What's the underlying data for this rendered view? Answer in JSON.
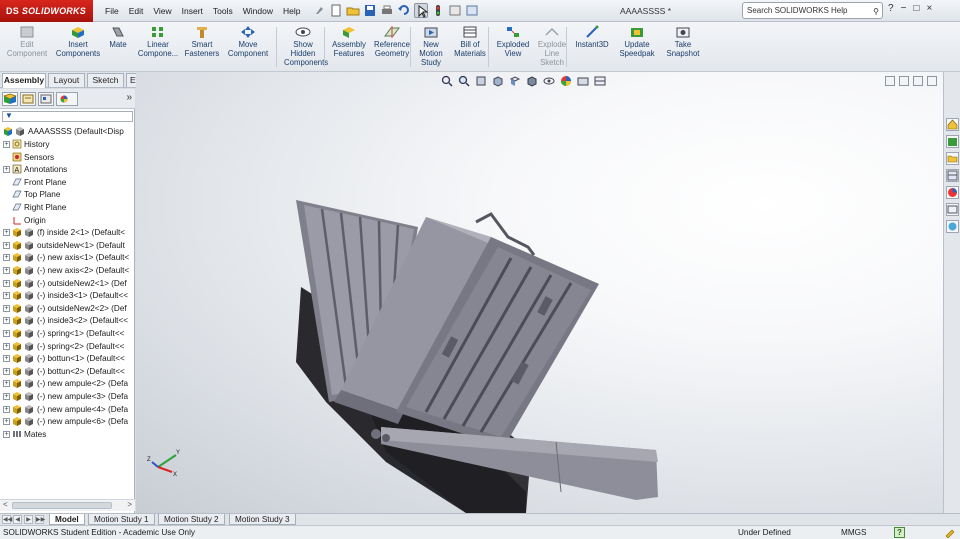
{
  "app": {
    "brand": "SOLIDWORKS",
    "brand_prefix": "DS",
    "document_title": "AAAASSSS *"
  },
  "menu": [
    "File",
    "Edit",
    "View",
    "Insert",
    "Tools",
    "Window",
    "Help"
  ],
  "search": {
    "placeholder": "Search SOLIDWORKS Help"
  },
  "window_controls": [
    "?",
    "−",
    "□",
    "×"
  ],
  "command_manager": [
    {
      "label": "Edit Component",
      "disabled": true,
      "icon": "edit-component-icon"
    },
    {
      "label": "Insert Components",
      "disabled": false,
      "icon": "insert-components-icon"
    },
    {
      "label": "Mate",
      "disabled": false,
      "icon": "mate-icon"
    },
    {
      "label": "Linear Compone...",
      "disabled": false,
      "icon": "linear-pattern-icon"
    },
    {
      "label": "Smart Fasteners",
      "disabled": false,
      "icon": "smart-fasteners-icon"
    },
    {
      "label": "Move Component",
      "disabled": false,
      "icon": "move-component-icon"
    },
    {
      "label": "Show Hidden Components",
      "disabled": false,
      "icon": "show-hidden-icon"
    },
    {
      "label": "Assembly Features",
      "disabled": false,
      "icon": "assembly-features-icon"
    },
    {
      "label": "Reference Geometry",
      "disabled": false,
      "icon": "reference-geometry-icon"
    },
    {
      "label": "New Motion Study",
      "disabled": false,
      "icon": "motion-study-icon"
    },
    {
      "label": "Bill of Materials",
      "disabled": false,
      "icon": "bom-icon"
    },
    {
      "label": "Exploded View",
      "disabled": false,
      "icon": "exploded-view-icon"
    },
    {
      "label": "Explode Line Sketch",
      "disabled": true,
      "icon": "explode-line-icon"
    },
    {
      "label": "Instant3D",
      "disabled": false,
      "icon": "instant3d-icon"
    },
    {
      "label": "Update Speedpak",
      "disabled": false,
      "icon": "speedpak-icon"
    },
    {
      "label": "Take Snapshot",
      "disabled": false,
      "icon": "snapshot-icon"
    }
  ],
  "command_tabs": [
    "Assembly",
    "Layout",
    "Sketch",
    "Evaluate"
  ],
  "tree": {
    "root": "AAAASSSS  (Default<Disp",
    "items": [
      {
        "label": "History",
        "type": "history",
        "expand": true
      },
      {
        "label": "Sensors",
        "type": "sensor",
        "expand": false
      },
      {
        "label": "Annotations",
        "type": "annotation",
        "expand": true
      },
      {
        "label": "Front Plane",
        "type": "plane",
        "expand": false
      },
      {
        "label": "Top Plane",
        "type": "plane",
        "expand": false
      },
      {
        "label": "Right Plane",
        "type": "plane",
        "expand": false
      },
      {
        "label": "Origin",
        "type": "origin",
        "expand": false
      },
      {
        "label": "(f) inside 2<1> (Default<",
        "type": "part",
        "expand": true
      },
      {
        "label": "outsideNew<1> (Default",
        "type": "part",
        "expand": true
      },
      {
        "label": "(-) new axis<1> (Default<",
        "type": "part",
        "expand": true
      },
      {
        "label": "(-) new axis<2> (Default<",
        "type": "part",
        "expand": true
      },
      {
        "label": "(-) outsideNew2<1> (Def",
        "type": "part",
        "expand": true
      },
      {
        "label": "(-) inside3<1> (Default<<",
        "type": "part",
        "expand": true
      },
      {
        "label": "(-) outsideNew2<2> (Def",
        "type": "part",
        "expand": true
      },
      {
        "label": "(-) inside3<2> (Default<<",
        "type": "part",
        "expand": true
      },
      {
        "label": "(-) spring<1> (Default<<",
        "type": "part",
        "expand": true
      },
      {
        "label": "(-) spring<2> (Default<<",
        "type": "part",
        "expand": true
      },
      {
        "label": "(-) bottun<1> (Default<<",
        "type": "part",
        "expand": true
      },
      {
        "label": "(-) bottun<2> (Default<<",
        "type": "part",
        "expand": true
      },
      {
        "label": "(-) new ampule<2> (Defa",
        "type": "part",
        "expand": true
      },
      {
        "label": "(-) new ampule<3> (Defa",
        "type": "part",
        "expand": true
      },
      {
        "label": "(-) new ampule<4> (Defa",
        "type": "part",
        "expand": true
      },
      {
        "label": "(-) new ampule<6> (Defa",
        "type": "part",
        "expand": true
      },
      {
        "label": "Mates",
        "type": "mates",
        "expand": true
      }
    ]
  },
  "bottom_tabs": [
    "Model",
    "Motion Study 1",
    "Motion Study 2",
    "Motion Study 3"
  ],
  "status": {
    "left": "SOLIDWORKS Student Edition - Academic Use Only",
    "definition": "Under Defined",
    "units": "MMGS",
    "help": "?"
  },
  "triad": {
    "x": "X",
    "y": "Y",
    "z": "Z"
  },
  "colors": {
    "brand_red": "#c8201a",
    "command_text": "#1c3d6b",
    "model_gray": "#8e8f9a",
    "model_dark": "#5e5f6a",
    "shadow": "#1e1e22"
  }
}
